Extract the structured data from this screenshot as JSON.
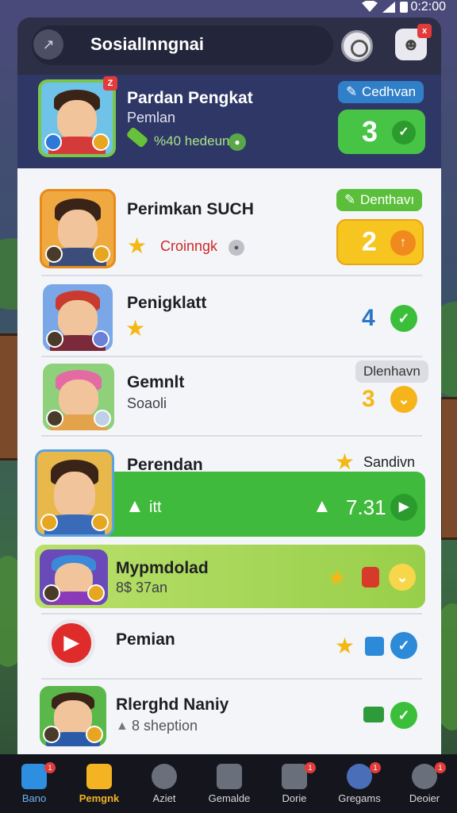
{
  "status_bar": {
    "time": "0:2:00"
  },
  "app_bar": {
    "title": "Sosiallnngnai",
    "profile_badge": "x",
    "back_icon": "back-icon",
    "camera_icon": "camera-icon",
    "profile_icon": "profile-icon"
  },
  "top_card": {
    "name": "Pardan Pengkat",
    "subtitle": "Pemlan",
    "detail": "%40 hedeun",
    "avatar_badge": "Z",
    "pill": "Cedhvan",
    "score": "3"
  },
  "rows": [
    {
      "name": "Perimkan SUCH",
      "detail": "Croinngk",
      "pill": "Denthavı",
      "score": "2"
    },
    {
      "name": "Penigklatt",
      "score": "4"
    },
    {
      "name": "Gemnlt",
      "subtitle": "Soaoli",
      "pill": "Dlenhavn",
      "score": "3"
    },
    {
      "name": "Perendan",
      "tag": "Sandivn",
      "left_value": "itt",
      "score": "7.31"
    },
    {
      "name": "Mypmdolad",
      "subtitle": "8$ 37an"
    },
    {
      "name": "Pemian"
    },
    {
      "name": "Rlerghd Naniy",
      "detail": "8 sheption"
    }
  ],
  "nav": [
    {
      "label": "Bano",
      "badge": "1",
      "color": "#2e8fe0"
    },
    {
      "label": "Pemgnk",
      "badge": "",
      "color": "#f3b323",
      "active": true
    },
    {
      "label": "Aziet",
      "badge": "",
      "color": "#8a8f9c"
    },
    {
      "label": "Gemalde",
      "badge": "",
      "color": "#8a8f9c"
    },
    {
      "label": "Dorie",
      "badge": "1",
      "color": "#8a8f9c"
    },
    {
      "label": "Gregams",
      "badge": "1",
      "color": "#8a8f9c"
    },
    {
      "label": "Deoier",
      "badge": "1",
      "color": "#8a8f9c"
    }
  ],
  "colors": {
    "green": "#3bbf3b",
    "yellow": "#f5c21b",
    "blue_pill": "#2c76c8",
    "dark": "#2f3766"
  }
}
